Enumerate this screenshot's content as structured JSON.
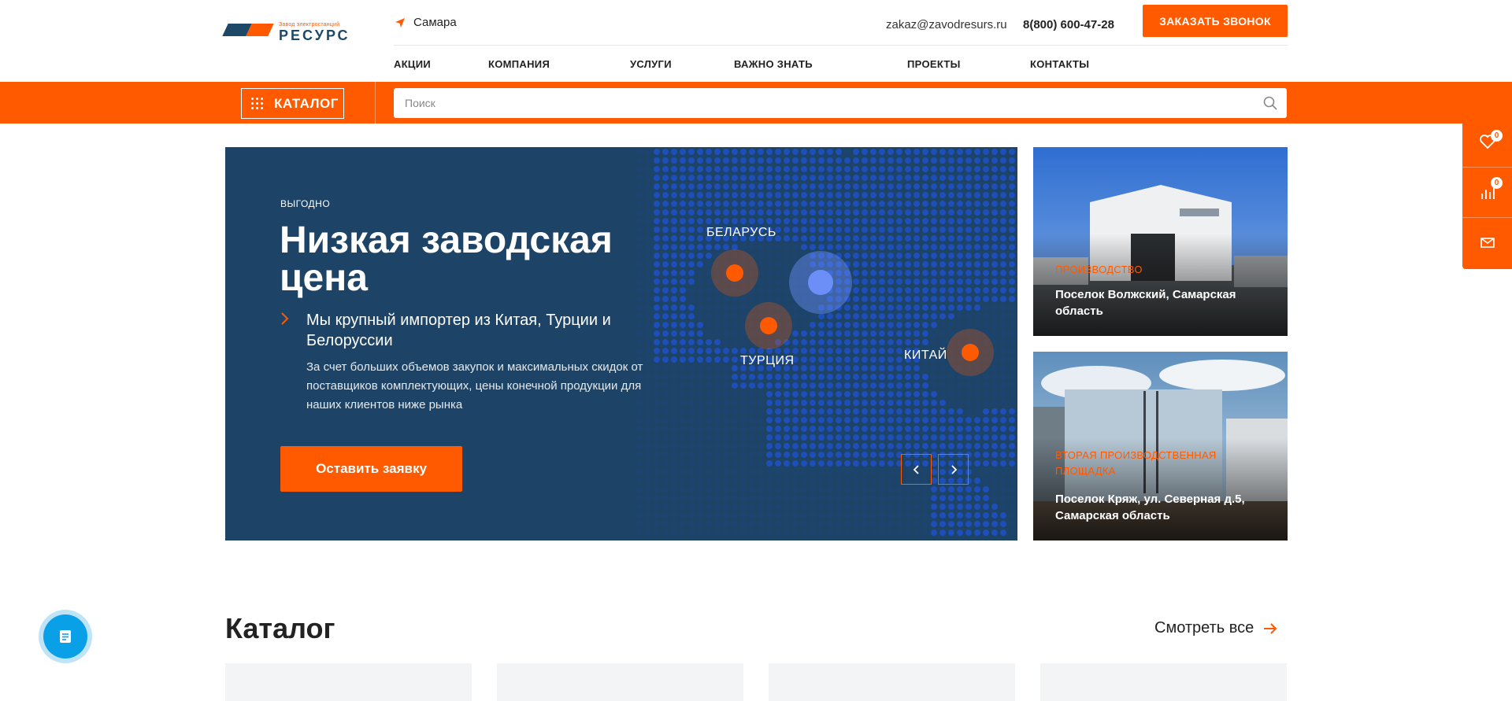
{
  "header": {
    "logo_small": "Завод электростанций",
    "logo_big": "РЕСУРС",
    "city": "Самара",
    "email": "zakaz@zavodresurs.ru",
    "phone": "8(800) 600-47-28",
    "callback_label": "ЗАКАЗАТЬ ЗВОНОК"
  },
  "nav": {
    "items": [
      {
        "label": "АКЦИИ"
      },
      {
        "label": "КОМПАНИЯ"
      },
      {
        "label": "УСЛУГИ"
      },
      {
        "label": "ВАЖНО ЗНАТЬ"
      },
      {
        "label": "ПРОЕКТЫ"
      },
      {
        "label": "КОНТАКТЫ"
      }
    ]
  },
  "catalog_bar": {
    "catalog_label": "КАТАЛОГ",
    "search_placeholder": "Поиск"
  },
  "hero": {
    "tag": "выгодно",
    "title": "Низкая заводская цена",
    "subtitle": "Мы крупный импортер из Китая, Турции и Белоруссии",
    "description": "За счет больших объемов закупок и максимальных скидок от поставщиков комплектующих, цены конечной продукции для наших клиентов ниже рынка",
    "button_label": "Оставить заявку",
    "map_labels": {
      "belarus": "БЕЛАРУСЬ",
      "turkey": "ТУРЦИЯ",
      "china": "КИТАЙ"
    }
  },
  "cards": [
    {
      "tag": "Производство",
      "title": "Поселок Волжский, Самарская область"
    },
    {
      "tag": "Вторая производственная площадка",
      "title": "Поселок Кряж, ул. Северная д.5, Самарская область"
    }
  ],
  "floating_panel": {
    "favorites_count": "0",
    "compare_count": "0"
  },
  "catalog": {
    "title": "Каталог",
    "see_all": "Смотреть все"
  },
  "colors": {
    "accent": "#ff5a00",
    "navy": "#1d4466",
    "chat": "#0aa0e8"
  }
}
